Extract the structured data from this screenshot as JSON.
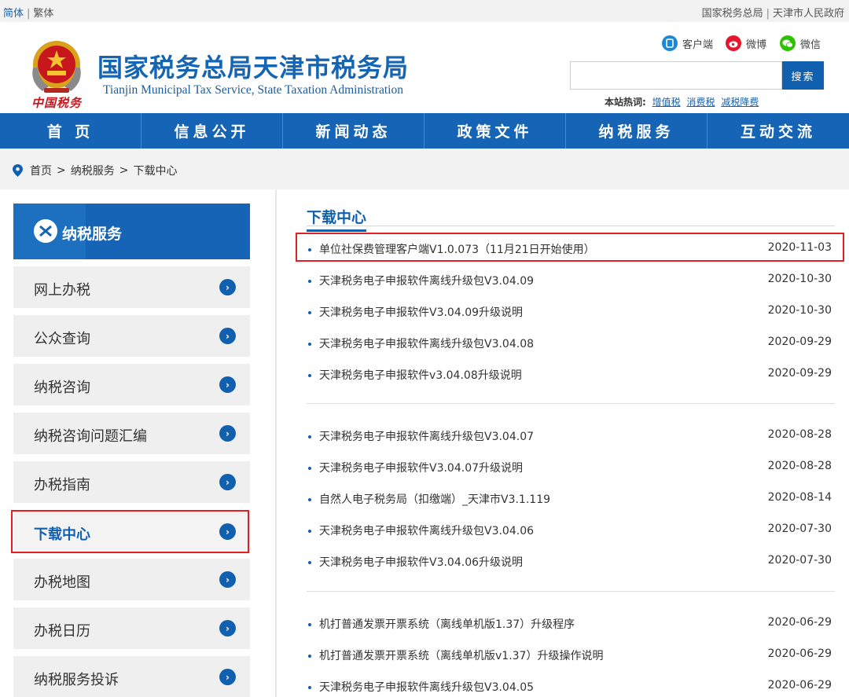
{
  "topbar": {
    "lang_simplified": "简体",
    "lang_traditional": "繁体",
    "link_sat": "国家税务总局",
    "link_gov": "天津市人民政府"
  },
  "header": {
    "emblem_text": "中国税务",
    "title": "国家税务总局天津市税务局",
    "subtitle": "Tianjin Municipal Tax Service, State Taxation Administration",
    "social": [
      {
        "label": "客户端",
        "icon": "client-icon",
        "color": "#1e88d8"
      },
      {
        "label": "微博",
        "icon": "weibo-icon",
        "color": "#e6162d"
      },
      {
        "label": "微信",
        "icon": "wechat-icon",
        "color": "#2dc100"
      }
    ],
    "search": {
      "button": "搜索"
    },
    "hot": {
      "label": "本站热词:",
      "words": [
        "增值税",
        "消费税",
        "减税降费"
      ]
    }
  },
  "nav": [
    "首 页",
    "信息公开",
    "新闻动态",
    "政策文件",
    "纳税服务",
    "互动交流"
  ],
  "breadcrumb": [
    "首页",
    "纳税服务",
    "下载中心"
  ],
  "sidebar": {
    "header": "纳税服务",
    "items": [
      {
        "label": "网上办税",
        "active": false
      },
      {
        "label": "公众查询",
        "active": false
      },
      {
        "label": "纳税咨询",
        "active": false
      },
      {
        "label": "纳税咨询问题汇编",
        "active": false
      },
      {
        "label": "办税指南",
        "active": false
      },
      {
        "label": "下载中心",
        "active": true
      },
      {
        "label": "办税地图",
        "active": false
      },
      {
        "label": "办税日历",
        "active": false
      },
      {
        "label": "纳税服务投诉",
        "active": false
      }
    ]
  },
  "content": {
    "title": "下载中心",
    "groups": [
      [
        {
          "title": "单位社保费管理客户端V1.0.073（11月21日开始使用）",
          "date": "2020-11-03",
          "highlighted": true
        },
        {
          "title": "天津税务电子申报软件离线升级包V3.04.09",
          "date": "2020-10-30"
        },
        {
          "title": "天津税务电子申报软件V3.04.09升级说明",
          "date": "2020-10-30"
        },
        {
          "title": "天津税务电子申报软件离线升级包V3.04.08",
          "date": "2020-09-29"
        },
        {
          "title": "天津税务电子申报软件v3.04.08升级说明",
          "date": "2020-09-29"
        }
      ],
      [
        {
          "title": "天津税务电子申报软件离线升级包V3.04.07",
          "date": "2020-08-28"
        },
        {
          "title": "天津税务电子申报软件V3.04.07升级说明",
          "date": "2020-08-28"
        },
        {
          "title": "自然人电子税务局（扣缴端）_天津市V3.1.119",
          "date": "2020-08-14"
        },
        {
          "title": "天津税务电子申报软件离线升级包V3.04.06",
          "date": "2020-07-30"
        },
        {
          "title": "天津税务电子申报软件V3.04.06升级说明",
          "date": "2020-07-30"
        }
      ],
      [
        {
          "title": "机打普通发票开票系统（离线单机版1.37）升级程序",
          "date": "2020-06-29"
        },
        {
          "title": "机打普通发票开票系统（离线单机版v1.37）升级操作说明",
          "date": "2020-06-29"
        },
        {
          "title": "天津税务电子申报软件离线升级包V3.04.05",
          "date": "2020-06-29"
        }
      ]
    ]
  },
  "colors": {
    "primary": "#1564b6",
    "highlight": "#e02020"
  }
}
